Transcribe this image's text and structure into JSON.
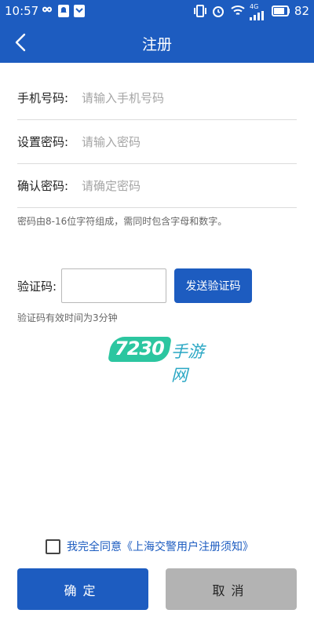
{
  "status_bar": {
    "time": "10:57",
    "network": "4G",
    "battery": "82",
    "icons": [
      "infinity-icon",
      "notification-icon",
      "mail-icon",
      "vibrate-icon",
      "alarm-icon",
      "wifi-icon",
      "signal-icon",
      "battery-icon"
    ]
  },
  "header": {
    "title": "注册",
    "back_icon": "chevron-left-icon",
    "bg_color": "#1d5cc0"
  },
  "form": {
    "phone": {
      "label": "手机号码:",
      "placeholder": "请输入手机号码",
      "value": ""
    },
    "password": {
      "label": "设置密码:",
      "placeholder": "请输入密码",
      "value": ""
    },
    "confirm": {
      "label": "确认密码:",
      "placeholder": "请确定密码",
      "value": ""
    },
    "password_hint": "密码由8-16位字符组成，需同时包含字母和数字。"
  },
  "verify": {
    "label": "验证码:",
    "value": "",
    "send_label": "发送验证码",
    "hint": "验证码有效时间为3分钟"
  },
  "watermark": {
    "number": "7230",
    "text": "手游网"
  },
  "agreement": {
    "checked": false,
    "prefix": "我完全同意",
    "link": "《上海交警用户注册须知》"
  },
  "actions": {
    "confirm_label": "确定",
    "cancel_label": "取消",
    "primary_color": "#1d5cc0",
    "secondary_color": "#b3b3b3"
  }
}
